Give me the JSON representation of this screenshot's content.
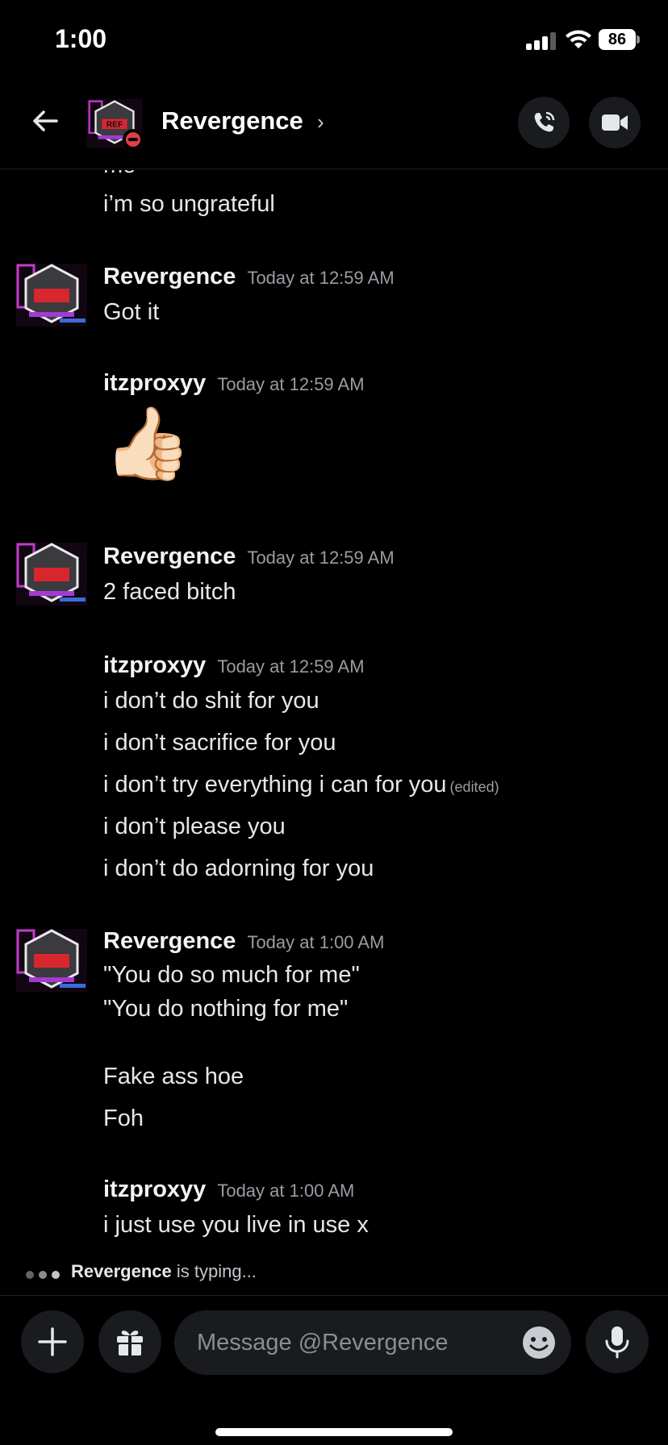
{
  "status_bar": {
    "time": "1:00",
    "battery": "86"
  },
  "header": {
    "title": "Revergence",
    "chevron": "›"
  },
  "messages": {
    "top_cut_line": "me",
    "m0_line": "i’m so ungrateful",
    "g1": {
      "name": "Revergence",
      "time": "Today at 12:59 AM",
      "lines": [
        "Got it"
      ]
    },
    "g2": {
      "name": "itzproxyy",
      "time": "Today at 12:59 AM",
      "emoji": "👍🏻"
    },
    "g3": {
      "name": "Revergence",
      "time": "Today at 12:59 AM",
      "lines": [
        "2 faced bitch"
      ]
    },
    "g4": {
      "name": "itzproxyy",
      "time": "Today at 12:59 AM",
      "lines": [
        "i don’t do shit for you",
        "i don’t sacrifice for you",
        "i don’t try everything i can for you",
        "i don’t please you",
        "i don’t do adorning for you"
      ],
      "edited": "(edited)"
    },
    "g5": {
      "name": "Revergence",
      "time": "Today at 1:00 AM",
      "lines": [
        "\"You do so much for me\"",
        "\"You do nothing for me\"",
        "Fake ass hoe",
        "Foh"
      ]
    },
    "g6": {
      "name": "itzproxyy",
      "time": "Today at 1:00 AM",
      "lines": [
        "i just use you live in use x"
      ]
    }
  },
  "typing": {
    "user": "Revergence",
    "suffix": " is typing..."
  },
  "composer": {
    "placeholder": "Message @Revergence"
  },
  "icons": [
    "back-arrow-icon",
    "chevron-right-icon",
    "phone-icon",
    "video-camera-icon",
    "plus-icon",
    "gift-icon",
    "emoji-icon",
    "microphone-icon"
  ],
  "colors": {
    "background": "#000000",
    "dnd_status": "#e03e45",
    "muted_text": "#9a9ca3"
  }
}
